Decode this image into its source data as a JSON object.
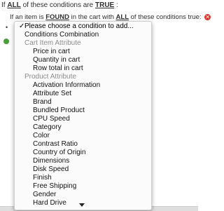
{
  "header": {
    "line1": {
      "pre": "If ",
      "agg": "ALL",
      "mid": " of these conditions are ",
      "val": "TRUE",
      "post": " :"
    },
    "line2": {
      "pre": "If an item is ",
      "found": "FOUND",
      "mid": " in the cart with ",
      "agg": "ALL",
      "post": " of these conditions true:"
    }
  },
  "dropdown": {
    "options": [
      {
        "label": "Please choose a condition to add...",
        "kind": "selected"
      },
      {
        "label": "Conditions Combination",
        "kind": "option"
      },
      {
        "label": "Cart Item Attribute",
        "kind": "group"
      },
      {
        "label": "Price in cart",
        "kind": "child"
      },
      {
        "label": "Quantity in cart",
        "kind": "child"
      },
      {
        "label": "Row total in cart",
        "kind": "child"
      },
      {
        "label": "Product Attribute",
        "kind": "group"
      },
      {
        "label": "Activation Information",
        "kind": "child"
      },
      {
        "label": "Attribute Set",
        "kind": "child"
      },
      {
        "label": "Brand",
        "kind": "child"
      },
      {
        "label": "Bundled Product",
        "kind": "child"
      },
      {
        "label": "CPU Speed",
        "kind": "child"
      },
      {
        "label": "Category",
        "kind": "child"
      },
      {
        "label": "Color",
        "kind": "child"
      },
      {
        "label": "Contrast Ratio",
        "kind": "child"
      },
      {
        "label": "Country of Origin",
        "kind": "child"
      },
      {
        "label": "Dimensions",
        "kind": "child"
      },
      {
        "label": "Disk Speed",
        "kind": "child"
      },
      {
        "label": "Finish",
        "kind": "child"
      },
      {
        "label": "Free Shipping",
        "kind": "child"
      },
      {
        "label": "Gender",
        "kind": "child"
      },
      {
        "label": "Hard Drive",
        "kind": "child"
      }
    ]
  },
  "colors": {
    "remove": "#d9342b",
    "add": "#4a9e3a",
    "group_text": "#8c8c8c"
  }
}
